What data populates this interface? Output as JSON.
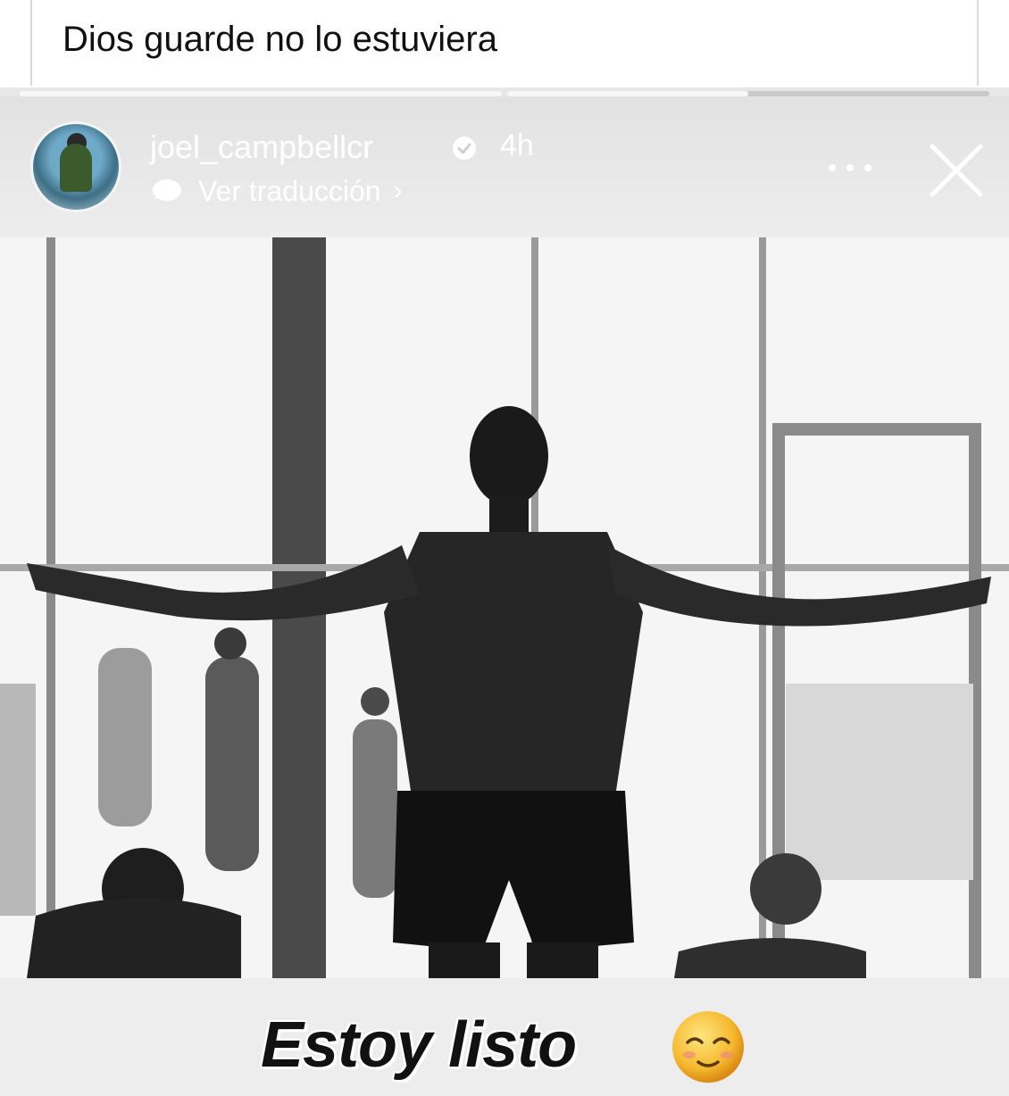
{
  "post": {
    "caption": "Dios guarde no lo estuviera"
  },
  "story": {
    "progress": [
      {
        "segment": 1,
        "fill": 1.0
      },
      {
        "segment": 2,
        "fill": 0.5
      },
      {
        "segment": 3,
        "fill": 0.0
      }
    ],
    "header": {
      "username": "joel_campbellcr",
      "verified": true,
      "time": "4h",
      "translate_label": "Ver traducción",
      "icons": [
        "avatar",
        "verified-badge-icon",
        "translate-bubble-icon",
        "chevron-right-icon",
        "more-options-icon",
        "close-icon"
      ]
    },
    "sticker_text": "Estoy listo",
    "sticker_emoji": "relieved-face-emoji",
    "colors": {
      "header_text": "#ffffff",
      "story_background": "#e7e7e7",
      "sticker_text": "#111111"
    }
  }
}
